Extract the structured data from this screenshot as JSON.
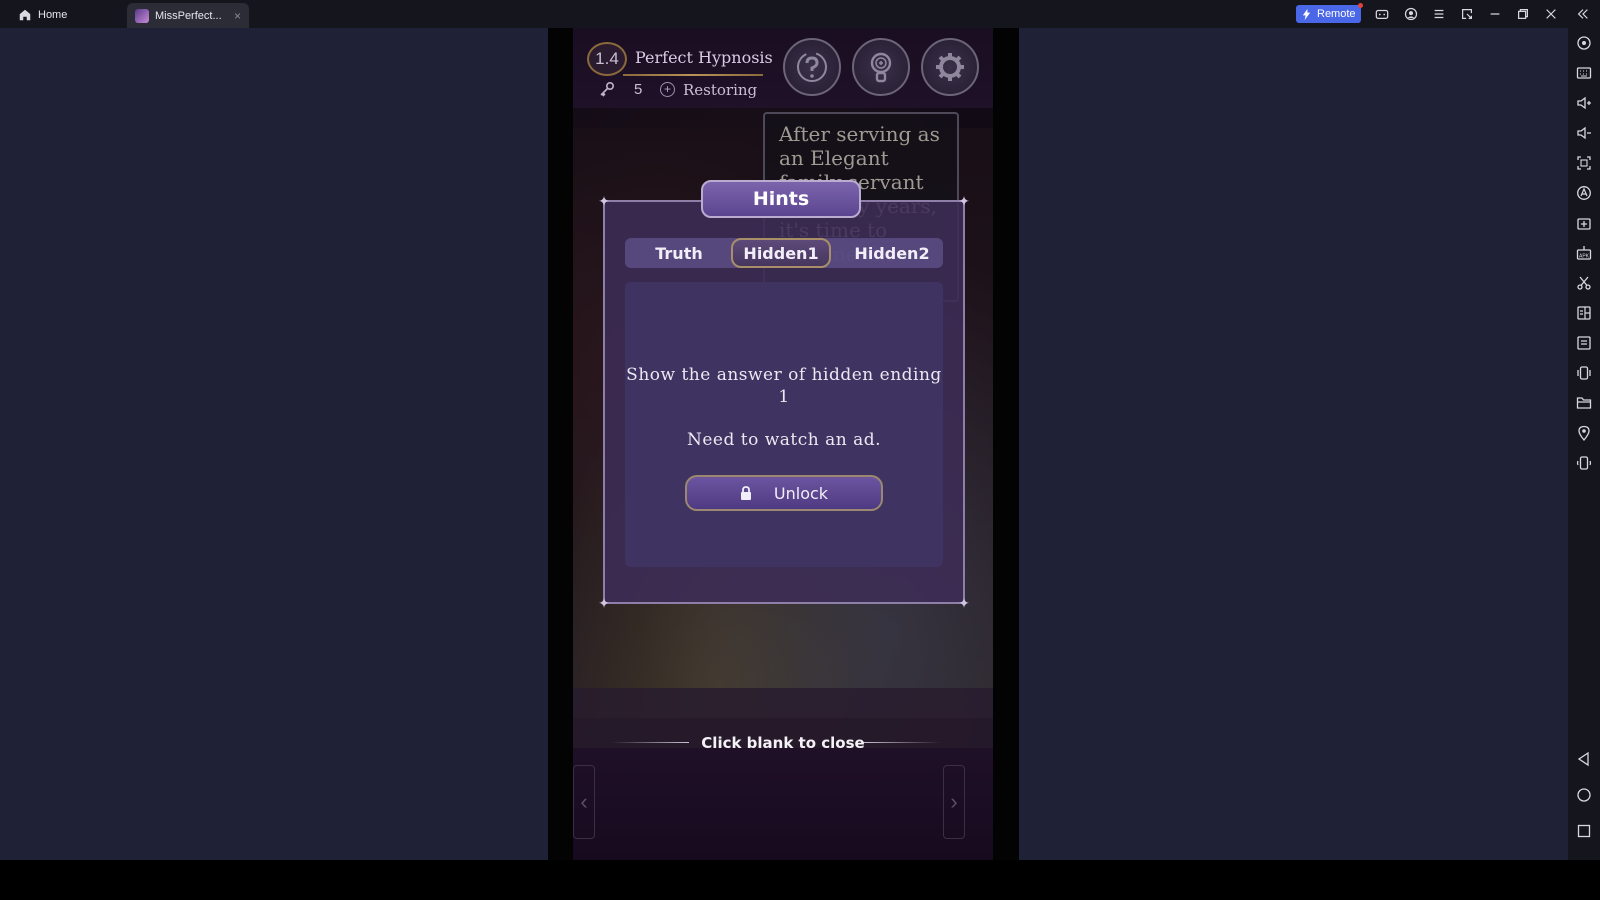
{
  "titlebar": {
    "home_tab_label": "Home",
    "app_tab_label": "MissPerfect...",
    "app_tab_close": "×",
    "remote_label": "Remote",
    "accent_color": "#4a67e8",
    "controls": [
      {
        "name": "gamepad-icon"
      },
      {
        "name": "account-icon"
      },
      {
        "name": "menu-icon"
      },
      {
        "name": "screen-resize-icon"
      },
      {
        "name": "minimize-icon"
      },
      {
        "name": "restore-icon"
      },
      {
        "name": "close-icon"
      },
      {
        "name": "collapse-sidebar-icon"
      }
    ]
  },
  "game": {
    "level_number": "1.4",
    "level_title": "Perfect Hypnosis",
    "keys_count": "5",
    "restore_plus": "+",
    "restoring_label": "Restoring",
    "story_text": "After serving as an Elegant family servant for many years, it's time to become the",
    "hints_modal": {
      "title": "Hints",
      "tabs": [
        {
          "label": "Truth",
          "active": false
        },
        {
          "label": "Hidden1",
          "active": true
        },
        {
          "label": "Hidden2",
          "active": false
        }
      ],
      "description": "Show the answer of hidden ending 1",
      "ad_note": "Need to watch an ad.",
      "unlock_label": "Unlock"
    },
    "close_hint": "Click blank to close",
    "prev_arrow": "‹",
    "next_arrow": "›"
  },
  "side_toolbar": {
    "items": [
      "settings-icon",
      "keyboard-icon",
      "volume-up-icon",
      "volume-down-icon",
      "screenshot-icon",
      "macro-icon",
      "apk-install-icon",
      "apk-icon",
      "cut-icon",
      "multi-instance-icon",
      "notes-icon",
      "shake-icon",
      "folder-icon",
      "location-icon",
      "rotate-icon",
      "back-icon",
      "home-circle-icon",
      "recent-apps-icon"
    ]
  }
}
